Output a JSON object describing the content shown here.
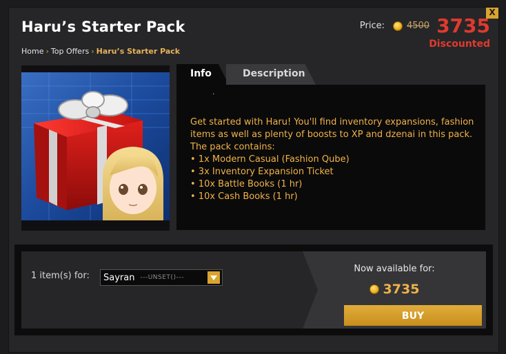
{
  "window": {
    "close_label": "X"
  },
  "header": {
    "title": "Haru’s Starter Pack",
    "price_label": "Price:",
    "old_price": "4500",
    "new_price": "3735",
    "status": "Discounted"
  },
  "breadcrumb": {
    "items": [
      "Home",
      "Top Offers",
      "Haru’s Starter Pack"
    ],
    "separator": "›"
  },
  "tabs": [
    {
      "label": "Info",
      "active": true
    },
    {
      "label": "Description",
      "active": false
    }
  ],
  "info": {
    "marker": ".",
    "lines": [
      "Get started with Haru! You'll find inventory expansions, fashion items as well as plenty of boosts to XP and dzenai in this pack.",
      "The pack contains:",
      "• 1x Modern Casual (Fashion Qube)",
      "• 3x Inventory Expansion Ticket",
      "• 10x Battle Books (1 hr)",
      "• 10x Cash Books (1 hr)"
    ]
  },
  "purchase": {
    "quantity_label": "1 item(s) for:",
    "recipient_value": "Sayran",
    "recipient_hint": "---UNSET()---",
    "available_label": "Now available for:",
    "price": "3735",
    "buy_label": "BUY"
  },
  "colors": {
    "accent": "#d9a42e",
    "discount_red": "#e03a2e",
    "info_text": "#f1b24a",
    "panel_dark": "#0a0a0a"
  },
  "icons": [
    "close-icon",
    "coin-icon",
    "dropdown-arrow-icon",
    "gift-box-icon"
  ]
}
